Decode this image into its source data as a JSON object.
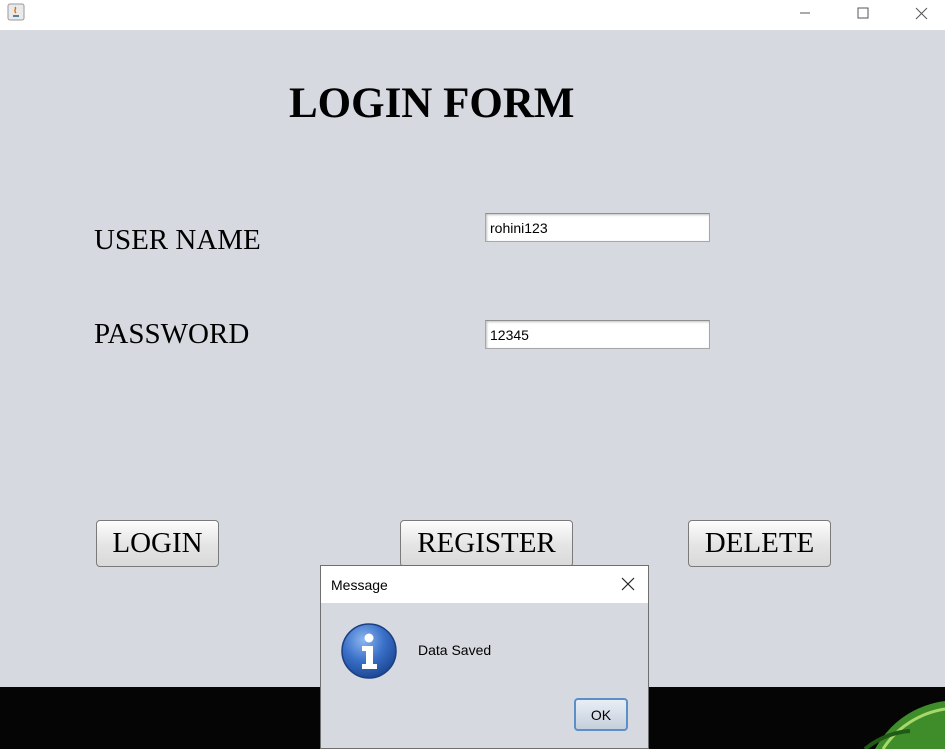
{
  "window": {
    "minimize_glyph": "—",
    "maximize_glyph": "☐",
    "close_glyph": "✕"
  },
  "form": {
    "title": "LOGIN FORM",
    "username_label": "USER NAME",
    "username_value": "rohini123",
    "password_label": "PASSWORD",
    "password_value": "12345"
  },
  "buttons": {
    "login": "LOGIN",
    "register": "REGISTER",
    "delete": "DELETE"
  },
  "dialog": {
    "title": "Message",
    "message": "Data Saved",
    "ok_label": "OK",
    "icon": "info-icon"
  },
  "colors": {
    "background": "#d6d9e0",
    "info_blue": "#2e63b8"
  }
}
